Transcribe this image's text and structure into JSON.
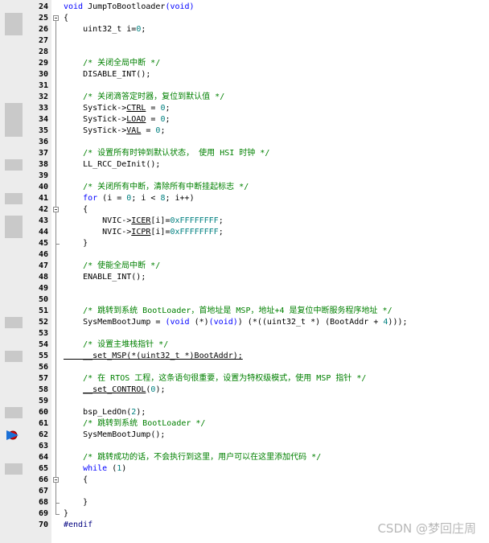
{
  "editor": {
    "lines": [
      {
        "n": 24,
        "bp": false,
        "cur": false,
        "tokens": [
          {
            "t": "void",
            "c": "kw"
          },
          {
            "t": " JumpToBootloader"
          },
          {
            "t": "(void)",
            "c": "kw"
          }
        ]
      },
      {
        "n": 25,
        "bp": true,
        "cur": false,
        "tokens": [
          {
            "t": "{"
          }
        ]
      },
      {
        "n": 26,
        "bp": true,
        "cur": false,
        "tokens": [
          {
            "t": "    uint32_t i="
          },
          {
            "t": "0",
            "c": "num"
          },
          {
            "t": ";"
          }
        ]
      },
      {
        "n": 27,
        "bp": false,
        "cur": false,
        "tokens": []
      },
      {
        "n": 28,
        "bp": false,
        "cur": false,
        "tokens": []
      },
      {
        "n": 29,
        "bp": false,
        "cur": false,
        "tokens": [
          {
            "t": "    "
          },
          {
            "t": "/* 关闭全局中断 */",
            "c": "cm"
          }
        ]
      },
      {
        "n": 30,
        "bp": false,
        "cur": false,
        "tokens": [
          {
            "t": "    DISABLE_INT();"
          }
        ]
      },
      {
        "n": 31,
        "bp": false,
        "cur": false,
        "tokens": []
      },
      {
        "n": 32,
        "bp": false,
        "cur": false,
        "tokens": [
          {
            "t": "    "
          },
          {
            "t": "/* 关闭滴答定时器，复位到默认值 */",
            "c": "cm"
          }
        ]
      },
      {
        "n": 33,
        "bp": true,
        "cur": false,
        "tokens": [
          {
            "t": "    SysTick->"
          },
          {
            "t": "CTRL",
            "c": "ul"
          },
          {
            "t": " = "
          },
          {
            "t": "0",
            "c": "num"
          },
          {
            "t": ";"
          }
        ]
      },
      {
        "n": 34,
        "bp": true,
        "cur": false,
        "tokens": [
          {
            "t": "    SysTick->"
          },
          {
            "t": "LOAD",
            "c": "ul"
          },
          {
            "t": " = "
          },
          {
            "t": "0",
            "c": "num"
          },
          {
            "t": ";"
          }
        ]
      },
      {
        "n": 35,
        "bp": true,
        "cur": false,
        "tokens": [
          {
            "t": "    SysTick->"
          },
          {
            "t": "VAL",
            "c": "ul"
          },
          {
            "t": " = "
          },
          {
            "t": "0",
            "c": "num"
          },
          {
            "t": ";"
          }
        ]
      },
      {
        "n": 36,
        "bp": false,
        "cur": false,
        "tokens": []
      },
      {
        "n": 37,
        "bp": false,
        "cur": false,
        "tokens": [
          {
            "t": "    "
          },
          {
            "t": "/* 设置所有时钟到默认状态， 使用 HSI 时钟 */",
            "c": "cm"
          }
        ]
      },
      {
        "n": 38,
        "bp": true,
        "cur": false,
        "tokens": [
          {
            "t": "    LL_RCC_DeInit();"
          }
        ]
      },
      {
        "n": 39,
        "bp": false,
        "cur": false,
        "tokens": []
      },
      {
        "n": 40,
        "bp": false,
        "cur": false,
        "tokens": [
          {
            "t": "    "
          },
          {
            "t": "/* 关闭所有中断，清除所有中断挂起标志 */",
            "c": "cm"
          }
        ]
      },
      {
        "n": 41,
        "bp": true,
        "cur": false,
        "tokens": [
          {
            "t": "    "
          },
          {
            "t": "for",
            "c": "kw"
          },
          {
            "t": " (i = "
          },
          {
            "t": "0",
            "c": "num"
          },
          {
            "t": "; i < "
          },
          {
            "t": "8",
            "c": "num"
          },
          {
            "t": "; i++)"
          }
        ]
      },
      {
        "n": 42,
        "bp": false,
        "cur": false,
        "tokens": [
          {
            "t": "    {"
          }
        ]
      },
      {
        "n": 43,
        "bp": true,
        "cur": false,
        "tokens": [
          {
            "t": "        NVIC->"
          },
          {
            "t": "ICER",
            "c": "ul"
          },
          {
            "t": "[i]="
          },
          {
            "t": "0xFFFFFFFF",
            "c": "num"
          },
          {
            "t": ";"
          }
        ]
      },
      {
        "n": 44,
        "bp": true,
        "cur": false,
        "tokens": [
          {
            "t": "        NVIC->"
          },
          {
            "t": "ICPR",
            "c": "ul"
          },
          {
            "t": "[i]="
          },
          {
            "t": "0xFFFFFFFF",
            "c": "num"
          },
          {
            "t": ";"
          }
        ]
      },
      {
        "n": 45,
        "bp": false,
        "cur": false,
        "tokens": [
          {
            "t": "    }"
          }
        ]
      },
      {
        "n": 46,
        "bp": false,
        "cur": false,
        "tokens": []
      },
      {
        "n": 47,
        "bp": false,
        "cur": false,
        "tokens": [
          {
            "t": "    "
          },
          {
            "t": "/* 使能全局中断 */",
            "c": "cm"
          }
        ]
      },
      {
        "n": 48,
        "bp": false,
        "cur": false,
        "tokens": [
          {
            "t": "    ENABLE_INT();"
          }
        ]
      },
      {
        "n": 49,
        "bp": false,
        "cur": false,
        "tokens": []
      },
      {
        "n": 50,
        "bp": false,
        "cur": false,
        "tokens": []
      },
      {
        "n": 51,
        "bp": false,
        "cur": false,
        "tokens": [
          {
            "t": "    "
          },
          {
            "t": "/* 跳转到系统 BootLoader，首地址是 MSP，地址+4 是复位中断服务程序地址 */",
            "c": "cm"
          }
        ]
      },
      {
        "n": 52,
        "bp": true,
        "cur": false,
        "tokens": [
          {
            "t": "    SysMemBootJump = "
          },
          {
            "t": "(void",
            "c": "kw"
          },
          {
            "t": " (*)"
          },
          {
            "t": "(void)",
            "c": "kw"
          },
          {
            "t": ") (*((uint32_t *) (BootAddr + "
          },
          {
            "t": "4",
            "c": "num"
          },
          {
            "t": ")));"
          }
        ]
      },
      {
        "n": 53,
        "bp": false,
        "cur": false,
        "tokens": []
      },
      {
        "n": 54,
        "bp": false,
        "cur": false,
        "tokens": [
          {
            "t": "    "
          },
          {
            "t": "/* 设置主堆栈指针 */",
            "c": "cm"
          }
        ]
      },
      {
        "n": 55,
        "bp": true,
        "cur": false,
        "tokens": [
          {
            "t": "    __set_MSP(*(uint32_t *)BootAddr);",
            "c": "ul"
          }
        ]
      },
      {
        "n": 56,
        "bp": false,
        "cur": false,
        "tokens": []
      },
      {
        "n": 57,
        "bp": false,
        "cur": false,
        "tokens": [
          {
            "t": "    "
          },
          {
            "t": "/* 在 RTOS 工程，这条语句很重要，设置为特权级模式，使用 MSP 指针 */",
            "c": "cm"
          }
        ]
      },
      {
        "n": 58,
        "bp": false,
        "cur": false,
        "tokens": [
          {
            "t": "    "
          },
          {
            "t": "__set_CONTROL",
            "c": "ul"
          },
          {
            "t": "("
          },
          {
            "t": "0",
            "c": "num"
          },
          {
            "t": ");"
          }
        ]
      },
      {
        "n": 59,
        "bp": false,
        "cur": false,
        "tokens": []
      },
      {
        "n": 60,
        "bp": true,
        "cur": false,
        "tokens": [
          {
            "t": "    bsp_LedOn("
          },
          {
            "t": "2",
            "c": "num"
          },
          {
            "t": ");"
          }
        ]
      },
      {
        "n": 61,
        "bp": false,
        "cur": false,
        "tokens": [
          {
            "t": "    "
          },
          {
            "t": "/* 跳转到系统 BootLoader */",
            "c": "cm"
          }
        ]
      },
      {
        "n": 62,
        "bp": false,
        "cur": true,
        "tokens": [
          {
            "t": "    SysMemBootJump();"
          }
        ]
      },
      {
        "n": 63,
        "bp": false,
        "cur": false,
        "tokens": []
      },
      {
        "n": 64,
        "bp": false,
        "cur": false,
        "tokens": [
          {
            "t": "    "
          },
          {
            "t": "/* 跳转成功的话，不会执行到这里，用户可以在这里添加代码 */",
            "c": "cm"
          }
        ]
      },
      {
        "n": 65,
        "bp": true,
        "cur": false,
        "tokens": [
          {
            "t": "    "
          },
          {
            "t": "while",
            "c": "kw"
          },
          {
            "t": " ("
          },
          {
            "t": "1",
            "c": "num"
          },
          {
            "t": ")"
          }
        ]
      },
      {
        "n": 66,
        "bp": false,
        "cur": false,
        "tokens": [
          {
            "t": "    {"
          }
        ]
      },
      {
        "n": 67,
        "bp": false,
        "cur": false,
        "tokens": []
      },
      {
        "n": 68,
        "bp": false,
        "cur": false,
        "tokens": [
          {
            "t": "    }"
          }
        ]
      },
      {
        "n": 69,
        "bp": false,
        "cur": false,
        "tokens": [
          {
            "t": "}"
          }
        ]
      },
      {
        "n": 70,
        "bp": false,
        "cur": false,
        "tokens": [
          {
            "t": "#endif",
            "c": "pp"
          }
        ]
      }
    ],
    "folds": [
      {
        "start": 25,
        "end": 69
      },
      {
        "start": 42,
        "end": 45
      },
      {
        "start": 66,
        "end": 68
      }
    ]
  },
  "watermark": "CSDN @梦回庄周",
  "colors": {
    "keyword": "#0000ff",
    "comment": "#008000",
    "number": "#008080",
    "preprocessor": "#000080",
    "breakpoint_marker": "#c9c9c9",
    "current_line_arrow": "#e00000"
  }
}
